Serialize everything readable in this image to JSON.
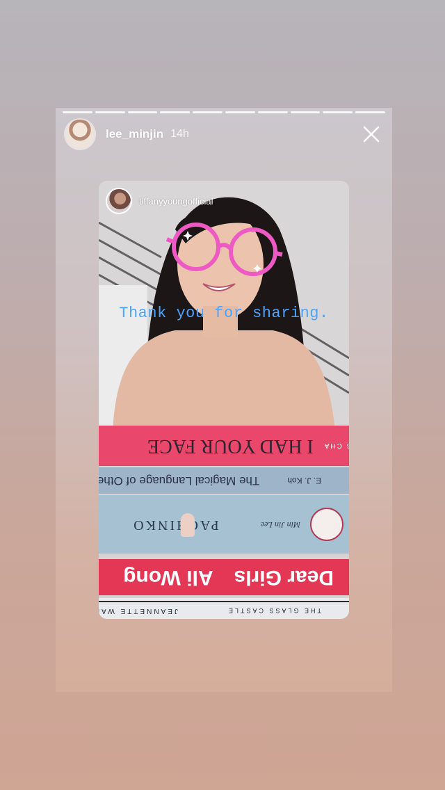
{
  "story": {
    "progress_segments": 10,
    "username": "lee_minjin",
    "time": "14h",
    "close_icon": "close-icon"
  },
  "card": {
    "username": "tiffanyyoungofficial",
    "overlay_text": "Thank you for sharing.",
    "colors": {
      "overlay_text": "#4aa3ff",
      "glasses": "#ee5ac3"
    }
  },
  "books": [
    {
      "title": "I HAD YOUR FACE",
      "author": "FRANCES CHA"
    },
    {
      "title": "The Magical Language of Others",
      "author": "E. J. Koh"
    },
    {
      "title": "PACHINKO",
      "author": "Min Jin Lee"
    },
    {
      "title": "Dear Girls",
      "author": "Ali Wong"
    },
    {
      "title": "THE GLASS CASTLE",
      "author": "JEANNETTE WALLS"
    }
  ]
}
